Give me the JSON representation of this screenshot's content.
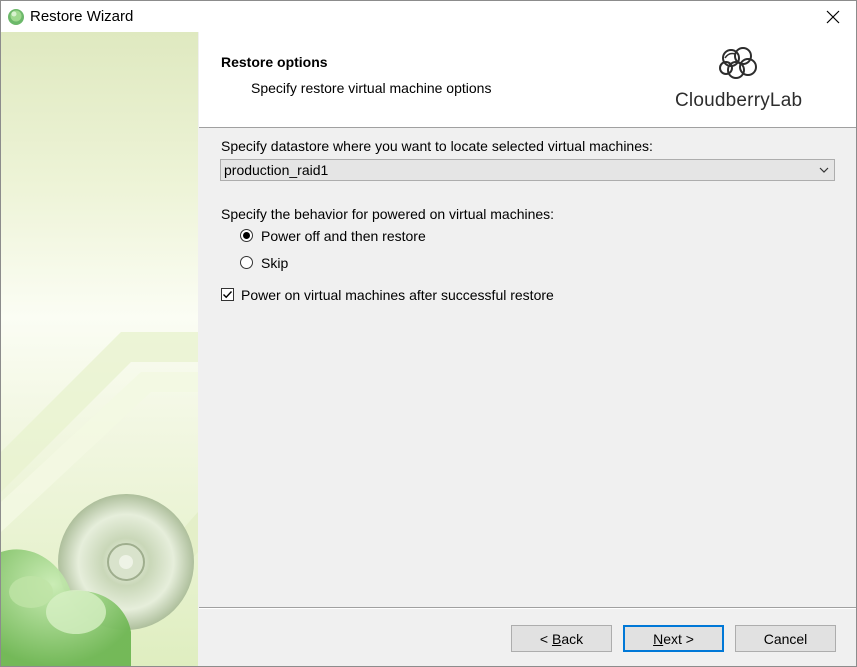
{
  "window": {
    "title": "Restore Wizard",
    "close_glyph": "✕"
  },
  "header": {
    "title": "Restore options",
    "subtitle": "Specify restore virtual machine options",
    "logo_text": "CloudberryLab"
  },
  "datastore": {
    "label": "Specify datastore where you want to locate selected virtual machines:",
    "selected": "production_raid1"
  },
  "behavior": {
    "label": "Specify the behavior for powered on virtual machines:",
    "options": [
      {
        "label": "Power off and then restore",
        "checked": true
      },
      {
        "label": "Skip",
        "checked": false
      }
    ]
  },
  "power_on": {
    "label": "Power on virtual machines after successful restore",
    "checked": true
  },
  "buttons": {
    "back": {
      "prefix": "< ",
      "accel": "B",
      "rest": "ack"
    },
    "next": {
      "accel": "N",
      "rest": "ext >"
    },
    "cancel": "Cancel"
  },
  "colors": {
    "accent": "#0078d7",
    "sidebar_green": "#8fc06a"
  },
  "icons": {
    "app": "cloud-gem-icon",
    "close": "close-icon",
    "dropdown": "chevron-down-icon",
    "check": "checkmark-icon",
    "logo": "cloud-logo-icon"
  }
}
